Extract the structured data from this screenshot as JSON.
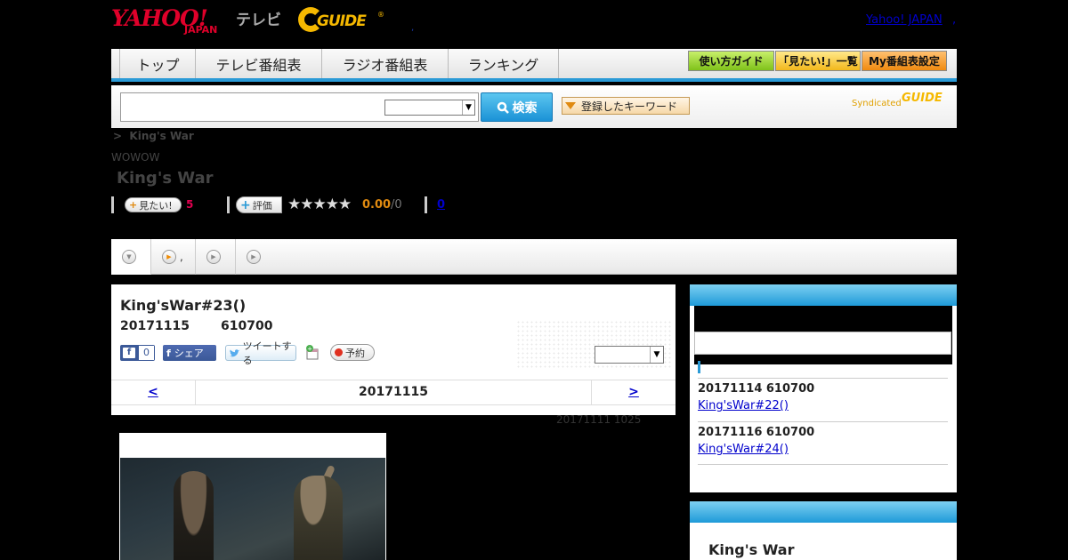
{
  "header": {
    "logo_yahoo": "YAHOO!",
    "logo_japan": "JAPAN",
    "logo_tv": "テレビ",
    "logo_guide": "GUIDE",
    "logo_reg": "®",
    "dot": ",",
    "yahoo_japan_link": "Yahoo! JAPAN",
    "trailing_dot": ","
  },
  "nav": {
    "tabs": [
      "トップ",
      "テレビ番組表",
      "ラジオ番組表",
      "ランキング"
    ],
    "guide_buttons": [
      "使い方ガイド",
      "「見たい!」一覧",
      "My番組表設定"
    ]
  },
  "search": {
    "button_label": "検索",
    "keyword_button": "登録したキーワード",
    "syndicated": "Syndicated",
    "syndicated_logo": "GUIDE"
  },
  "breadcrumb": {
    "sep": ">",
    "current": "King's War"
  },
  "program": {
    "channel": "WOWOW",
    "title": "King's War",
    "mitai_label": "見たい!",
    "mitai_count": "5",
    "hyoka_label": "評価",
    "stars": "★★★★★",
    "score": "0.00",
    "score_count": "/0",
    "review_link": "0"
  },
  "tabs": [
    {
      "label": ""
    },
    {
      "label": ","
    },
    {
      "label": ""
    },
    {
      "label": ""
    }
  ],
  "episode": {
    "title": "King'sWar#23()",
    "date": "20171115",
    "time": "610700",
    "fb_like_count": "0",
    "fb_share": "シェア",
    "tweet": "ツイートする",
    "yoyaku": "予約",
    "prev": "<",
    "nav_date": "20171115",
    "next": ">",
    "updated": "20171111  1025"
  },
  "sidebar": {
    "items": [
      {
        "date": "20171114  610700",
        "link": "King'sWar#22()"
      },
      {
        "date": "20171116  610700",
        "link": "King'sWar#24()"
      }
    ],
    "second_title": "King's War"
  },
  "colors": {
    "accent_blue": "#2a9ad6",
    "yahoo_red": "#e0002a",
    "guide_yellow": "#f5b800"
  }
}
